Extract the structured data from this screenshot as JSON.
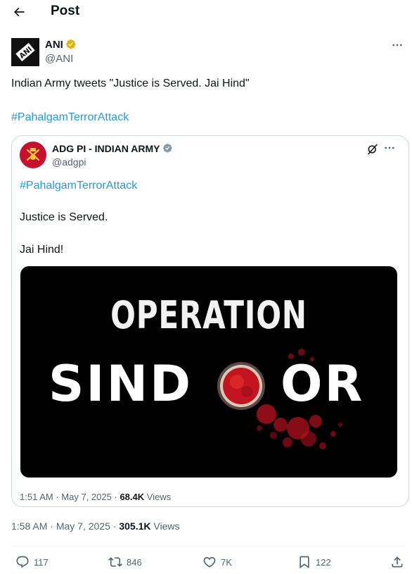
{
  "header": {
    "title": "Post"
  },
  "post": {
    "author_name": "ANI",
    "author_handle": "@ANI",
    "avatar_text": "ANI",
    "text": "Indian Army tweets \"Justice is Served. Jai Hind\"",
    "hashtag": "#PahalgamTerrorAttack",
    "time": "1:58 AM",
    "date": "May 7, 2025",
    "views": "305.1K",
    "views_label": "Views"
  },
  "quote": {
    "author_name": "ADG PI - INDIAN ARMY",
    "author_handle": "@adgpi",
    "hashtag": "#PahalgamTerrorAttack",
    "line1": "Justice is Served.",
    "line2": "Jai Hind!",
    "media": {
      "line1": "OPERATION",
      "line2_left": "SIND",
      "line2_right": "OR"
    },
    "time": "1:51 AM",
    "date": "May 7, 2025",
    "views": "68.4K",
    "views_label": "Views"
  },
  "actions": {
    "replies": "117",
    "reposts": "846",
    "likes": "7K",
    "bookmarks": "122"
  },
  "colors": {
    "link": "#1d9bf0",
    "verified_gold": "#e8b300",
    "verified_gray": "#829aab",
    "sindoor_red": "#c8102e"
  }
}
